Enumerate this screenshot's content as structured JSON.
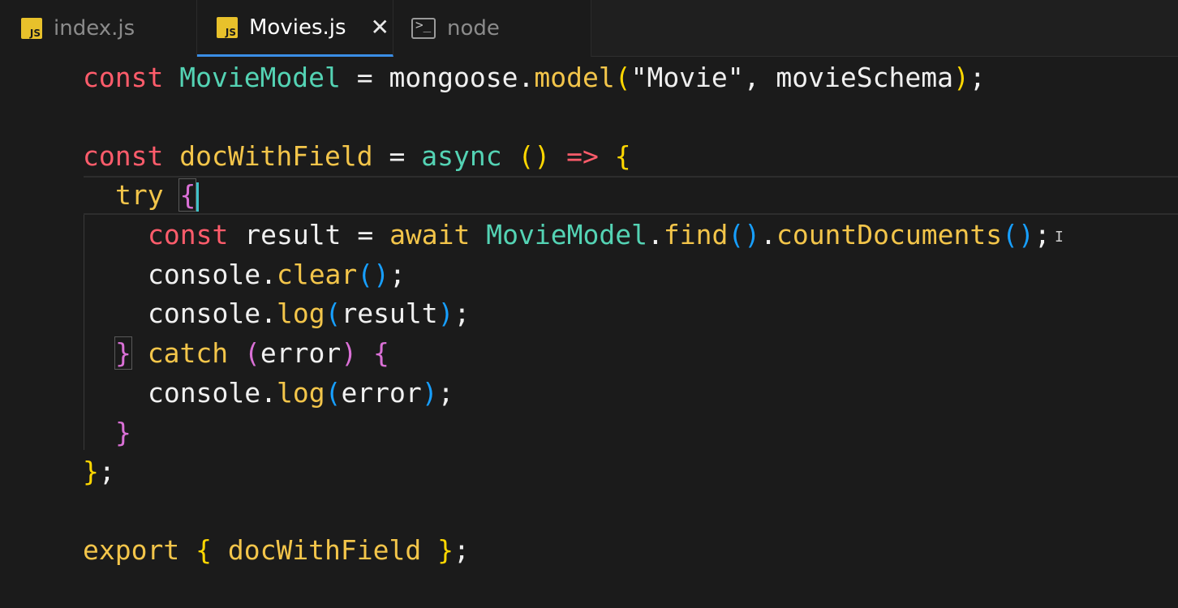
{
  "tabs": [
    {
      "label": "index.js",
      "icon": "js-file-icon",
      "icon_text": "JS",
      "active": false
    },
    {
      "label": "Movies.js",
      "icon": "js-file-icon",
      "icon_text": "JS",
      "active": true,
      "close": "✕"
    },
    {
      "label": "node",
      "icon": "terminal-icon",
      "icon_text": ">_",
      "active": false
    }
  ],
  "code": {
    "l1": {
      "kw": "const",
      "name": "MovieModel",
      "eq": "=",
      "obj": "mongoose",
      "dot": ".",
      "method": "model",
      "open": "(",
      "str": "\"Movie\"",
      "comma": ",",
      "arg": "movieSchema",
      "close": ")",
      "semi": ";"
    },
    "l2": {
      "kw": "const",
      "name": "docWithField",
      "eq": "=",
      "async": "async",
      "params": "()",
      "arrow": "=>",
      "brace": "{"
    },
    "l3": {
      "kw": "try",
      "brace": "{"
    },
    "l4": {
      "kw": "const",
      "name": "result",
      "eq": "=",
      "await": "await",
      "cls": "MovieModel",
      "dot1": ".",
      "m1": "find",
      "p1": "()",
      "dot2": ".",
      "m2": "countDocuments",
      "p2": "()",
      "semi": ";"
    },
    "l5": {
      "obj": "console",
      "dot": ".",
      "method": "clear",
      "p": "()",
      "semi": ";"
    },
    "l6": {
      "obj": "console",
      "dot": ".",
      "method": "log",
      "open": "(",
      "arg": "result",
      "close": ")",
      "semi": ";"
    },
    "l7": {
      "rbrace": "}",
      "kw": "catch",
      "open": "(",
      "arg": "error",
      "close": ")",
      "brace": "{"
    },
    "l8": {
      "obj": "console",
      "dot": ".",
      "method": "log",
      "open": "(",
      "arg": "error",
      "close": ")",
      "semi": ";"
    },
    "l9": {
      "rbrace": "}"
    },
    "l10": {
      "rbrace": "}",
      "semi": ";"
    },
    "l11": {
      "kw": "export",
      "open": "{",
      "name": "docWithField",
      "close": "}",
      "semi": ";"
    }
  },
  "colors": {
    "keyword": "#ff5c6b",
    "class": "#54d3b4",
    "function": "#f3c54a",
    "bracket1": "#ffd700",
    "bracket2": "#da70d6",
    "bracket3": "#179fff",
    "active_tab_border": "#3a8ee6",
    "cursor": "#3fc2c9"
  }
}
